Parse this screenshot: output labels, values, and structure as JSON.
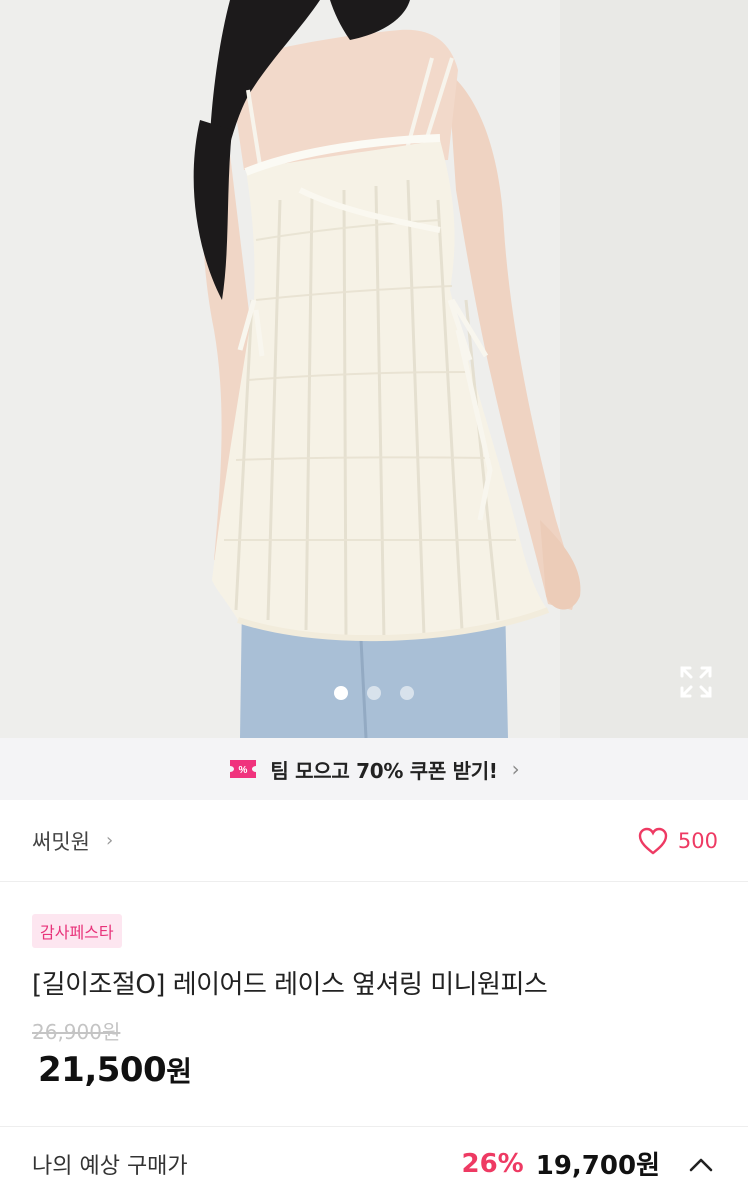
{
  "gallery": {
    "slide_count": 3,
    "active_index": 0
  },
  "banner": {
    "text": "팀 모으고 70% 쿠폰 받기!",
    "chevron": "›",
    "icon": "coupon-icon"
  },
  "store": {
    "name": "써밋원",
    "chevron": "›",
    "likes": "500"
  },
  "product": {
    "badge": "감사페스타",
    "title": "[길이조절O] 레이어드 레이스 옆셔링 미니원피스",
    "original_price": "26,900원",
    "price_value": "21,500",
    "price_unit": "원"
  },
  "expected": {
    "label": "나의 예상 구매가",
    "discount_rate": "26%",
    "price": "19,700원"
  },
  "colors": {
    "accent": "#ee3a63",
    "badge_bg": "#fde6f0",
    "badge_text": "#e8337a"
  }
}
